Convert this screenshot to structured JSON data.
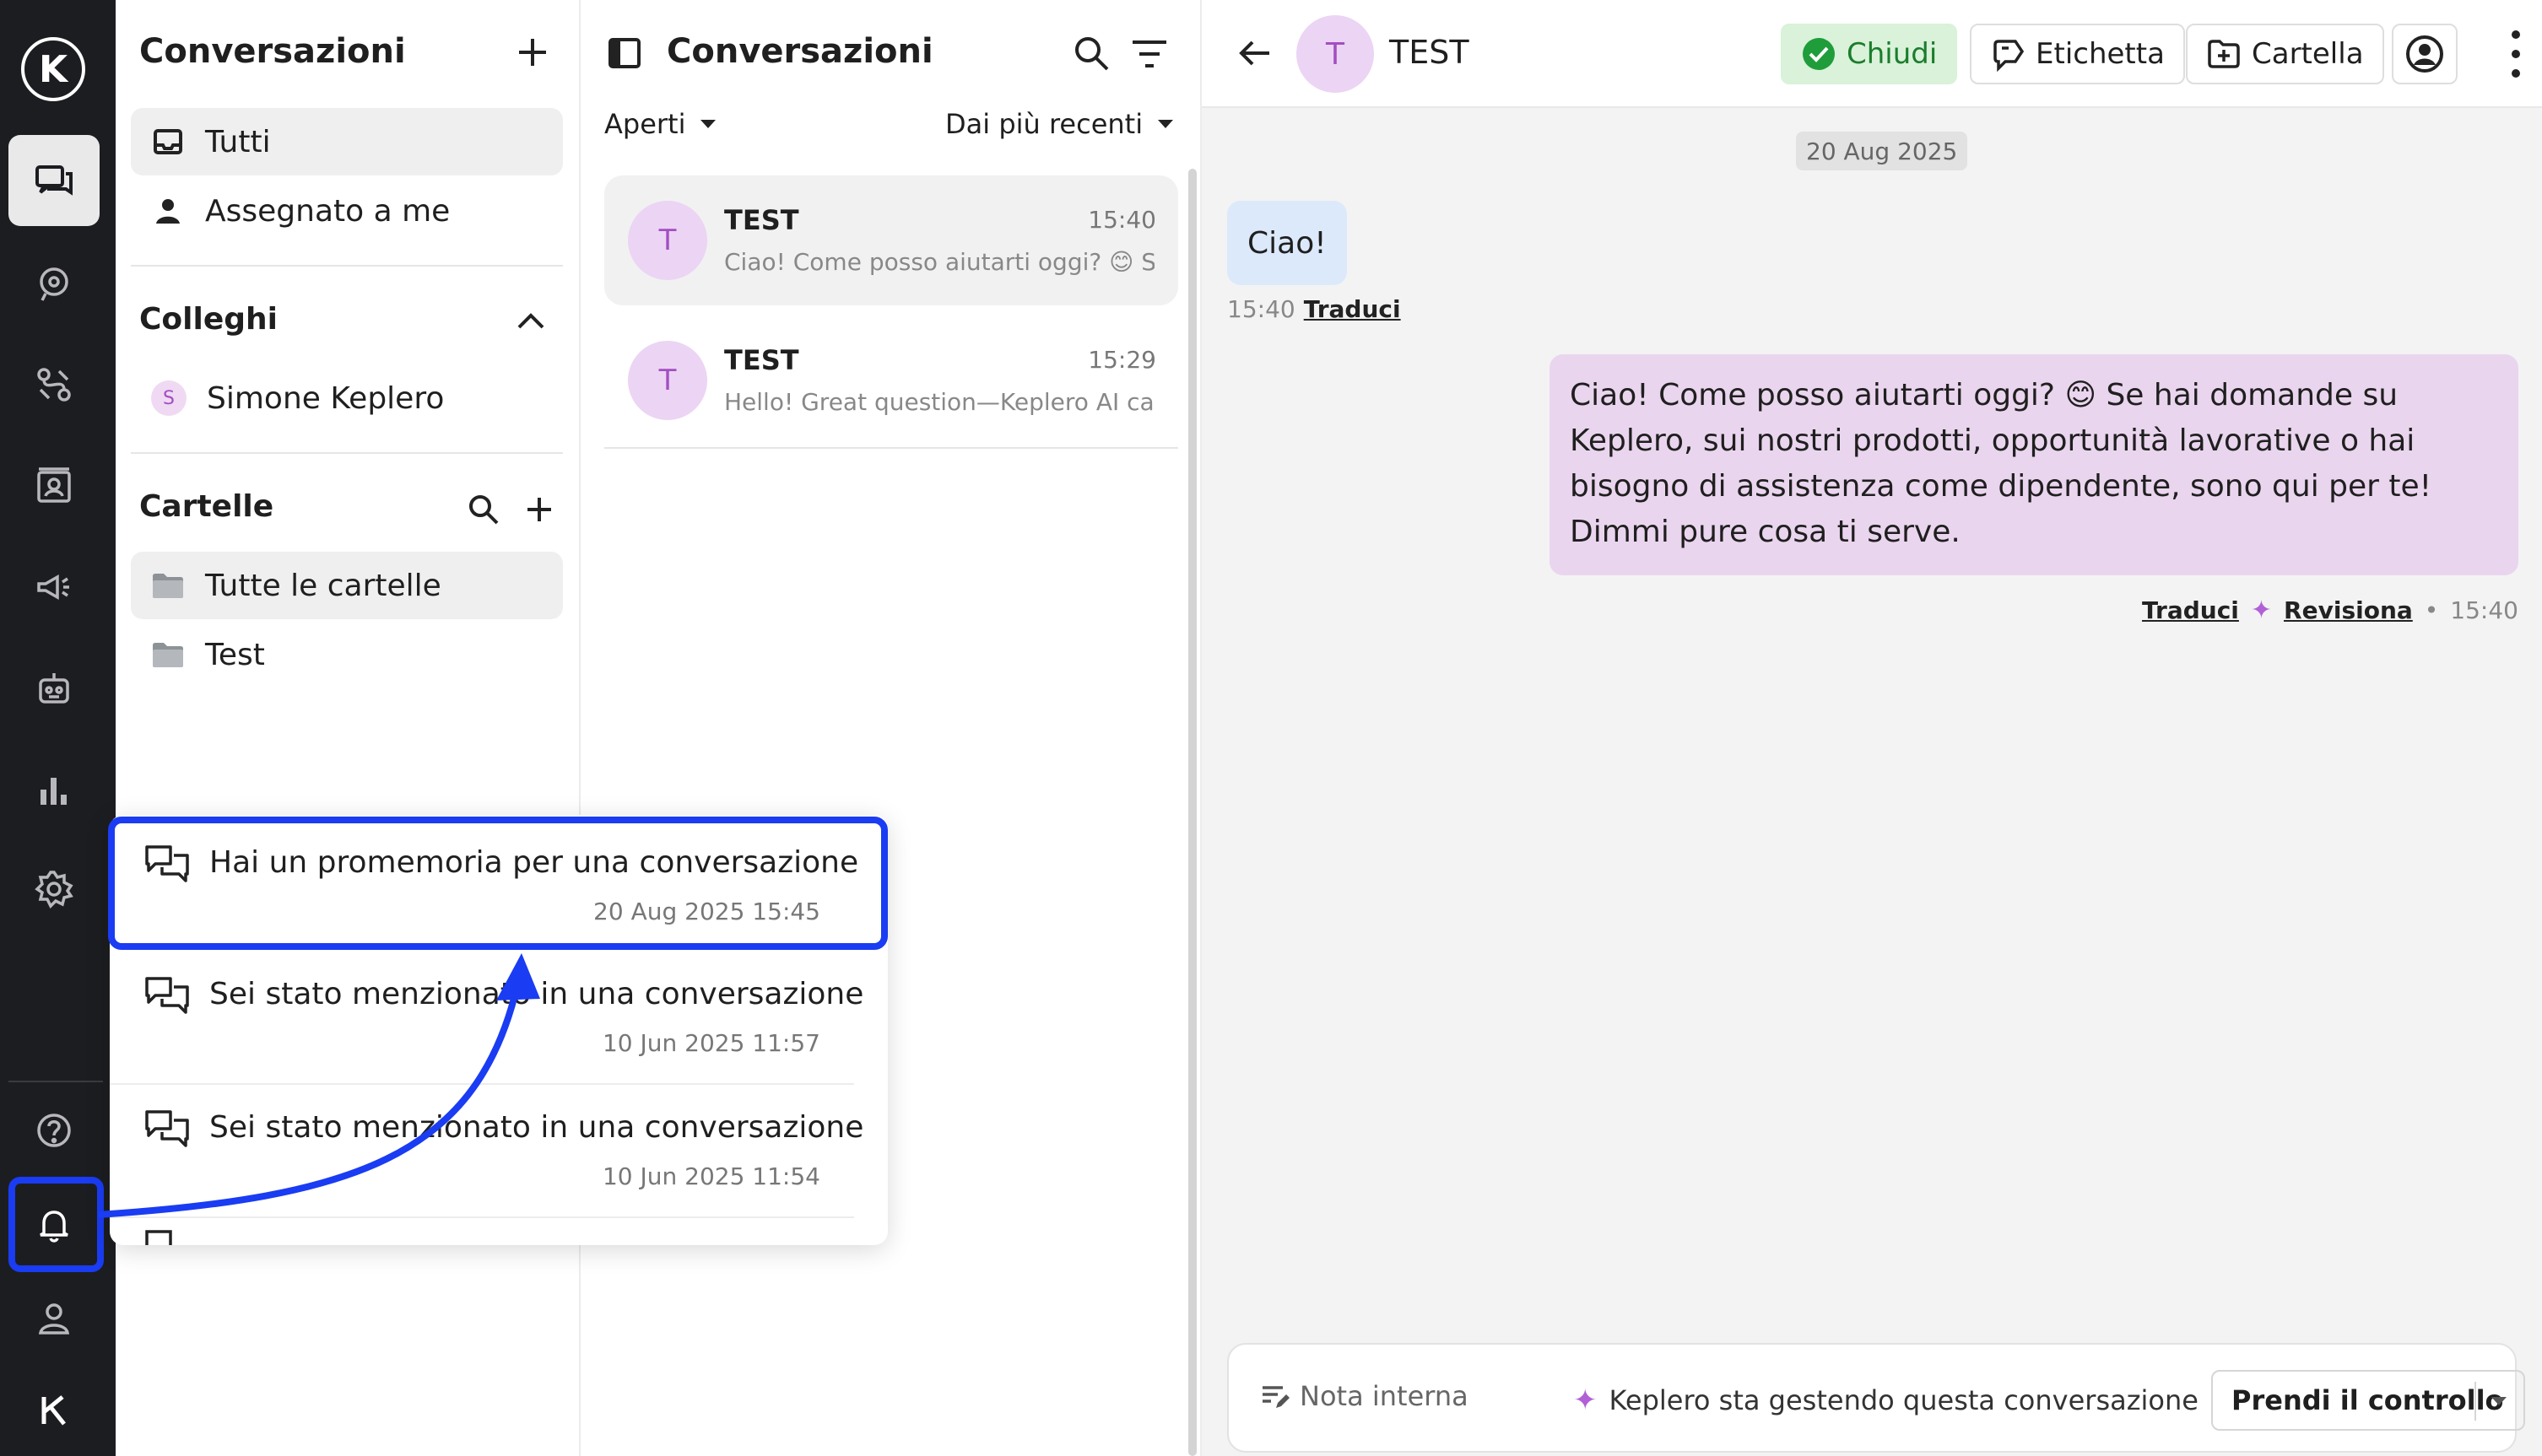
{
  "rail": {
    "logo_letter": "K",
    "items": [
      {
        "name": "conversations-icon",
        "active": true
      },
      {
        "name": "support-icon"
      },
      {
        "name": "integrations-icon"
      },
      {
        "name": "contacts-icon"
      },
      {
        "name": "campaigns-icon"
      },
      {
        "name": "bot-icon"
      },
      {
        "name": "analytics-icon"
      },
      {
        "name": "settings-icon"
      },
      {
        "name": "help-icon"
      },
      {
        "name": "bell-icon"
      },
      {
        "name": "profile-icon"
      },
      {
        "name": "brand-logo-icon"
      }
    ]
  },
  "sidebar": {
    "title": "Conversazioni",
    "views": [
      {
        "label": "Tutti",
        "icon": "inbox-icon",
        "active": true
      },
      {
        "label": "Assegnato a me",
        "icon": "person-icon"
      }
    ],
    "colleagues": {
      "title": "Colleghi",
      "items": [
        {
          "initial": "S",
          "label": "Simone Keplero"
        }
      ]
    },
    "folders": {
      "title": "Cartelle",
      "items": [
        {
          "label": "Tutte le cartelle",
          "active": true
        },
        {
          "label": "Test"
        }
      ]
    }
  },
  "notifications": {
    "items": [
      {
        "title": "Hai un promemoria per una conversazione",
        "time": "20 Aug 2025 15:45",
        "highlighted": true
      },
      {
        "title": "Sei stato menzionato in una conversazione",
        "time": "10 Jun 2025 11:57"
      },
      {
        "title": "Sei stato menzionato in una conversazione",
        "time": "10 Jun 2025 11:54"
      }
    ]
  },
  "conversation_list": {
    "title": "Conversazioni",
    "status_filter": "Aperti",
    "sort": "Dai più recenti",
    "items": [
      {
        "initial": "T",
        "name": "TEST",
        "time": "15:40",
        "preview": "Ciao! Come posso aiutarti oggi? 😊 Se hai domande su Keplero",
        "active": true
      },
      {
        "initial": "T",
        "name": "TEST",
        "time": "15:29",
        "preview": "Hello! Great question—Keplero AI can help"
      }
    ]
  },
  "chat": {
    "contact_initial": "T",
    "contact_name": "TEST",
    "actions": {
      "close": "Chiudi",
      "label": "Etichetta",
      "folder": "Cartella"
    },
    "date": "20 Aug 2025",
    "messages": [
      {
        "direction": "in",
        "text": "Ciao!",
        "time": "15:40",
        "translate": "Traduci"
      },
      {
        "direction": "out",
        "text": "Ciao! Come posso aiutarti oggi? 😊 Se hai domande su Keplero, sui nostri prodotti, opportunità lavorative o hai bisogno di assistenza come dipendente, sono qui per te! Dimmi pure cosa ti serve.",
        "time": "15:40",
        "translate": "Traduci",
        "revise": "Revisiona"
      }
    ],
    "composer": {
      "internal_note": "Nota interna",
      "status": "Keplero sta gestendo questa conversazione",
      "take_control": "Prendi il controllo"
    }
  },
  "colors": {
    "rail_bg": "#1c1d21",
    "highlight": "#1a3cf2",
    "avatar_bg": "#ecd4f4",
    "avatar_fg": "#a24fc2",
    "incoming_bubble": "#dce9fb",
    "outgoing_bubble": "#ead5ee",
    "close_button_bg": "#d9f2d9"
  }
}
